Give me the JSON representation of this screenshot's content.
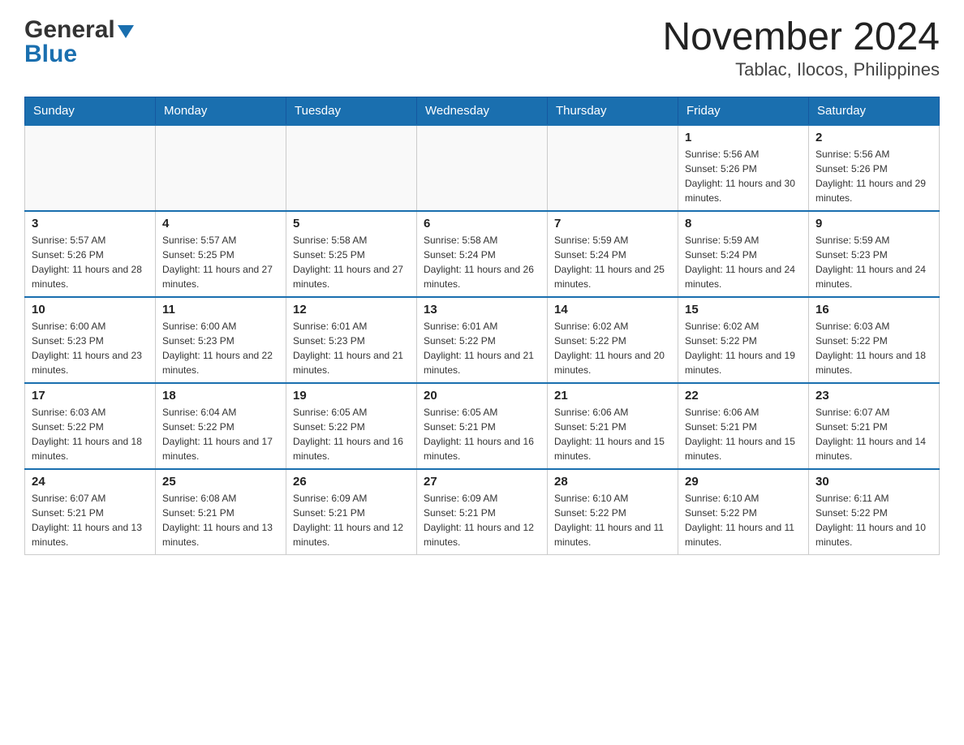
{
  "logo": {
    "general": "General",
    "blue": "Blue"
  },
  "title": "November 2024",
  "subtitle": "Tablac, Ilocos, Philippines",
  "weekdays": [
    "Sunday",
    "Monday",
    "Tuesday",
    "Wednesday",
    "Thursday",
    "Friday",
    "Saturday"
  ],
  "weeks": [
    [
      {
        "day": "",
        "sunrise": "",
        "sunset": "",
        "daylight": ""
      },
      {
        "day": "",
        "sunrise": "",
        "sunset": "",
        "daylight": ""
      },
      {
        "day": "",
        "sunrise": "",
        "sunset": "",
        "daylight": ""
      },
      {
        "day": "",
        "sunrise": "",
        "sunset": "",
        "daylight": ""
      },
      {
        "day": "",
        "sunrise": "",
        "sunset": "",
        "daylight": ""
      },
      {
        "day": "1",
        "sunrise": "Sunrise: 5:56 AM",
        "sunset": "Sunset: 5:26 PM",
        "daylight": "Daylight: 11 hours and 30 minutes."
      },
      {
        "day": "2",
        "sunrise": "Sunrise: 5:56 AM",
        "sunset": "Sunset: 5:26 PM",
        "daylight": "Daylight: 11 hours and 29 minutes."
      }
    ],
    [
      {
        "day": "3",
        "sunrise": "Sunrise: 5:57 AM",
        "sunset": "Sunset: 5:26 PM",
        "daylight": "Daylight: 11 hours and 28 minutes."
      },
      {
        "day": "4",
        "sunrise": "Sunrise: 5:57 AM",
        "sunset": "Sunset: 5:25 PM",
        "daylight": "Daylight: 11 hours and 27 minutes."
      },
      {
        "day": "5",
        "sunrise": "Sunrise: 5:58 AM",
        "sunset": "Sunset: 5:25 PM",
        "daylight": "Daylight: 11 hours and 27 minutes."
      },
      {
        "day": "6",
        "sunrise": "Sunrise: 5:58 AM",
        "sunset": "Sunset: 5:24 PM",
        "daylight": "Daylight: 11 hours and 26 minutes."
      },
      {
        "day": "7",
        "sunrise": "Sunrise: 5:59 AM",
        "sunset": "Sunset: 5:24 PM",
        "daylight": "Daylight: 11 hours and 25 minutes."
      },
      {
        "day": "8",
        "sunrise": "Sunrise: 5:59 AM",
        "sunset": "Sunset: 5:24 PM",
        "daylight": "Daylight: 11 hours and 24 minutes."
      },
      {
        "day": "9",
        "sunrise": "Sunrise: 5:59 AM",
        "sunset": "Sunset: 5:23 PM",
        "daylight": "Daylight: 11 hours and 24 minutes."
      }
    ],
    [
      {
        "day": "10",
        "sunrise": "Sunrise: 6:00 AM",
        "sunset": "Sunset: 5:23 PM",
        "daylight": "Daylight: 11 hours and 23 minutes."
      },
      {
        "day": "11",
        "sunrise": "Sunrise: 6:00 AM",
        "sunset": "Sunset: 5:23 PM",
        "daylight": "Daylight: 11 hours and 22 minutes."
      },
      {
        "day": "12",
        "sunrise": "Sunrise: 6:01 AM",
        "sunset": "Sunset: 5:23 PM",
        "daylight": "Daylight: 11 hours and 21 minutes."
      },
      {
        "day": "13",
        "sunrise": "Sunrise: 6:01 AM",
        "sunset": "Sunset: 5:22 PM",
        "daylight": "Daylight: 11 hours and 21 minutes."
      },
      {
        "day": "14",
        "sunrise": "Sunrise: 6:02 AM",
        "sunset": "Sunset: 5:22 PM",
        "daylight": "Daylight: 11 hours and 20 minutes."
      },
      {
        "day": "15",
        "sunrise": "Sunrise: 6:02 AM",
        "sunset": "Sunset: 5:22 PM",
        "daylight": "Daylight: 11 hours and 19 minutes."
      },
      {
        "day": "16",
        "sunrise": "Sunrise: 6:03 AM",
        "sunset": "Sunset: 5:22 PM",
        "daylight": "Daylight: 11 hours and 18 minutes."
      }
    ],
    [
      {
        "day": "17",
        "sunrise": "Sunrise: 6:03 AM",
        "sunset": "Sunset: 5:22 PM",
        "daylight": "Daylight: 11 hours and 18 minutes."
      },
      {
        "day": "18",
        "sunrise": "Sunrise: 6:04 AM",
        "sunset": "Sunset: 5:22 PM",
        "daylight": "Daylight: 11 hours and 17 minutes."
      },
      {
        "day": "19",
        "sunrise": "Sunrise: 6:05 AM",
        "sunset": "Sunset: 5:22 PM",
        "daylight": "Daylight: 11 hours and 16 minutes."
      },
      {
        "day": "20",
        "sunrise": "Sunrise: 6:05 AM",
        "sunset": "Sunset: 5:21 PM",
        "daylight": "Daylight: 11 hours and 16 minutes."
      },
      {
        "day": "21",
        "sunrise": "Sunrise: 6:06 AM",
        "sunset": "Sunset: 5:21 PM",
        "daylight": "Daylight: 11 hours and 15 minutes."
      },
      {
        "day": "22",
        "sunrise": "Sunrise: 6:06 AM",
        "sunset": "Sunset: 5:21 PM",
        "daylight": "Daylight: 11 hours and 15 minutes."
      },
      {
        "day": "23",
        "sunrise": "Sunrise: 6:07 AM",
        "sunset": "Sunset: 5:21 PM",
        "daylight": "Daylight: 11 hours and 14 minutes."
      }
    ],
    [
      {
        "day": "24",
        "sunrise": "Sunrise: 6:07 AM",
        "sunset": "Sunset: 5:21 PM",
        "daylight": "Daylight: 11 hours and 13 minutes."
      },
      {
        "day": "25",
        "sunrise": "Sunrise: 6:08 AM",
        "sunset": "Sunset: 5:21 PM",
        "daylight": "Daylight: 11 hours and 13 minutes."
      },
      {
        "day": "26",
        "sunrise": "Sunrise: 6:09 AM",
        "sunset": "Sunset: 5:21 PM",
        "daylight": "Daylight: 11 hours and 12 minutes."
      },
      {
        "day": "27",
        "sunrise": "Sunrise: 6:09 AM",
        "sunset": "Sunset: 5:21 PM",
        "daylight": "Daylight: 11 hours and 12 minutes."
      },
      {
        "day": "28",
        "sunrise": "Sunrise: 6:10 AM",
        "sunset": "Sunset: 5:22 PM",
        "daylight": "Daylight: 11 hours and 11 minutes."
      },
      {
        "day": "29",
        "sunrise": "Sunrise: 6:10 AM",
        "sunset": "Sunset: 5:22 PM",
        "daylight": "Daylight: 11 hours and 11 minutes."
      },
      {
        "day": "30",
        "sunrise": "Sunrise: 6:11 AM",
        "sunset": "Sunset: 5:22 PM",
        "daylight": "Daylight: 11 hours and 10 minutes."
      }
    ]
  ]
}
